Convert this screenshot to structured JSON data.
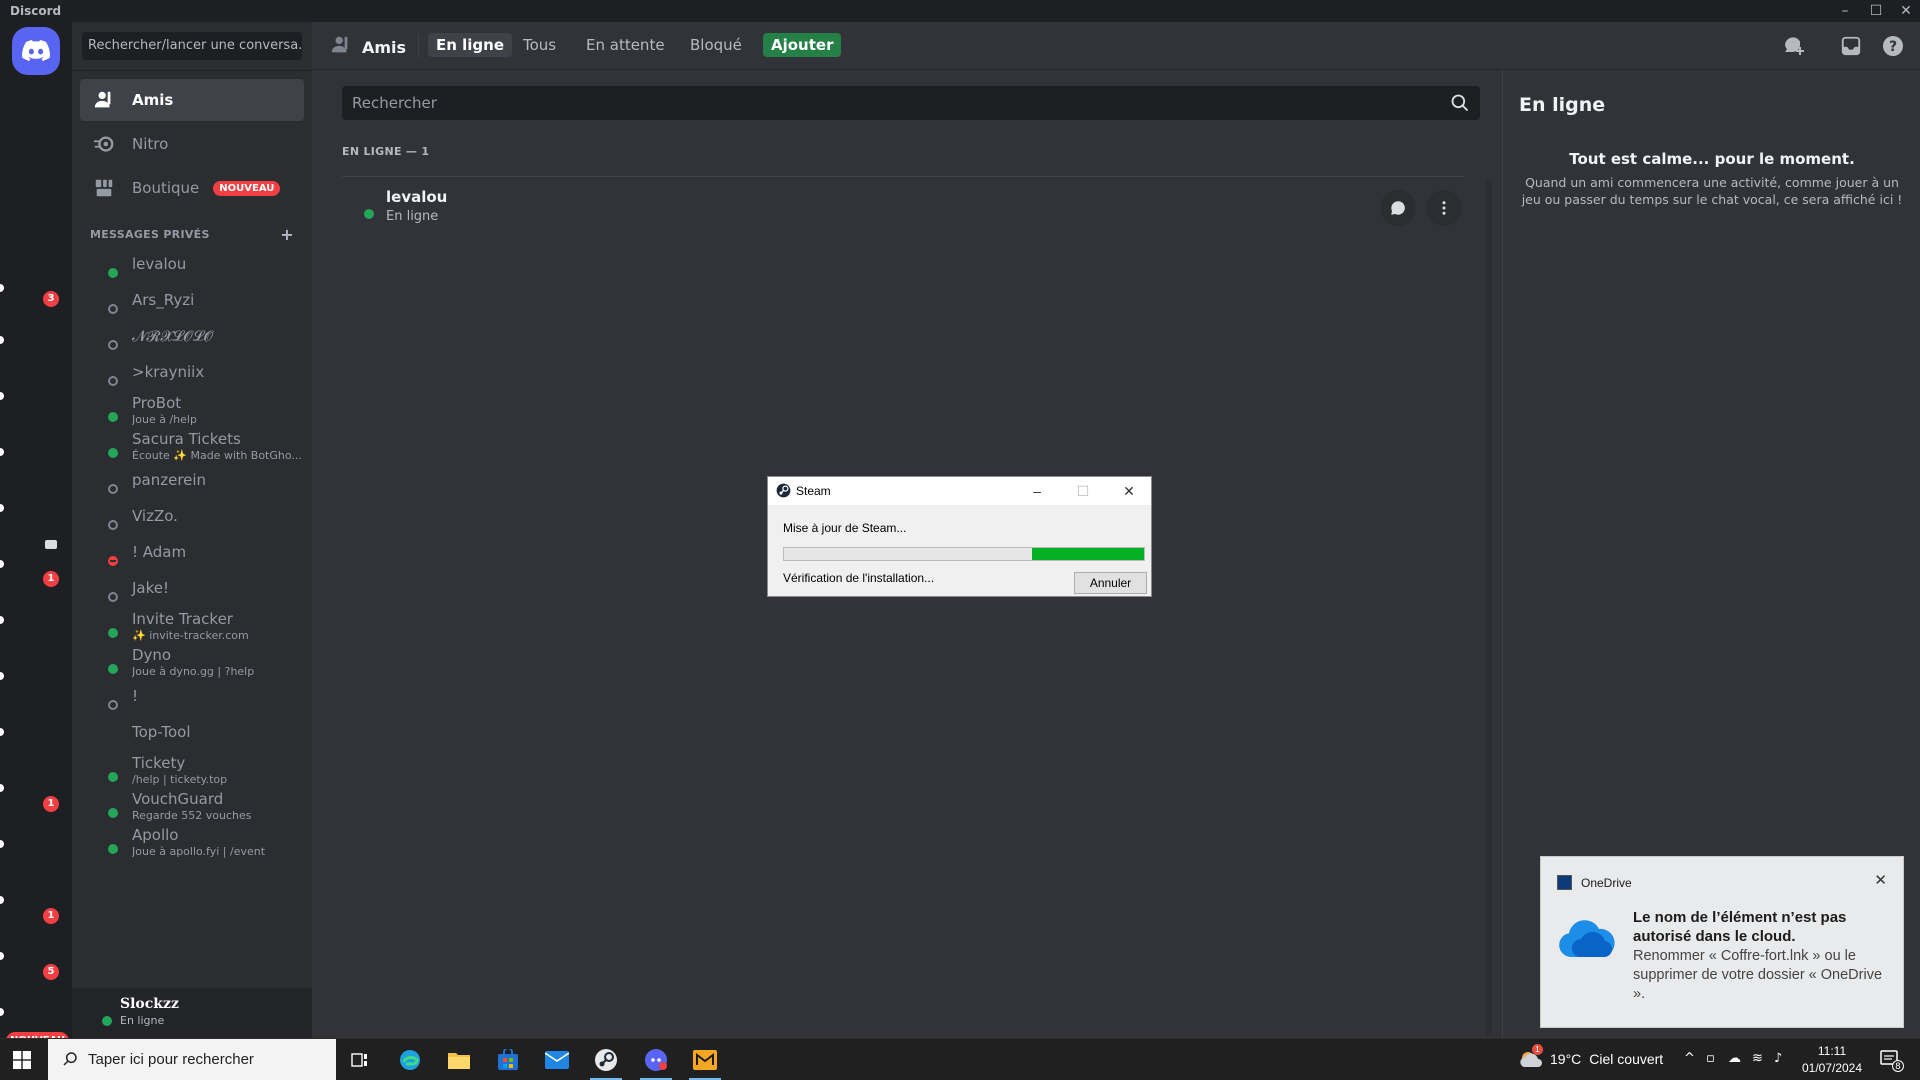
{
  "window": {
    "title": "Discord"
  },
  "rail": {
    "badges": [
      "3",
      "1",
      "1",
      "1",
      "5"
    ],
    "new_label": "NOUVEAU"
  },
  "sidebar": {
    "search_placeholder": "Rechercher/lancer une conversa...",
    "nav": [
      {
        "label": "Amis",
        "icon": "friends-icon"
      },
      {
        "label": "Nitro",
        "icon": "nitro-icon"
      },
      {
        "label": "Boutique",
        "icon": "shop-icon",
        "badge": "NOUVEAU"
      }
    ],
    "dm_header": "MESSAGES PRIVÉS",
    "dms": [
      {
        "name": "levalou",
        "sub": "",
        "status": "online"
      },
      {
        "name": "Ars_Ryzi",
        "sub": "",
        "status": "offline"
      },
      {
        "name": "𝓝𝓡𝓧𝓛𝓞𝓛𝓞",
        "sub": "",
        "status": "offline"
      },
      {
        "name": ">krayniix",
        "sub": "",
        "status": "offline"
      },
      {
        "name": "ProBot",
        "sub": "Joue à /help",
        "status": "online"
      },
      {
        "name": "Sacura Tickets",
        "sub": "Écoute ✨ Made with BotGho...",
        "status": "online"
      },
      {
        "name": "panzerein",
        "sub": "",
        "status": "offline"
      },
      {
        "name": "VizZo.",
        "sub": "",
        "status": "offline"
      },
      {
        "name": "! Adam",
        "sub": "",
        "status": "dnd"
      },
      {
        "name": "Jake!",
        "sub": "",
        "status": "offline"
      },
      {
        "name": "Invite Tracker",
        "sub": "✨ invite-tracker.com",
        "status": "online"
      },
      {
        "name": "Dyno",
        "sub": "Joue à dyno.gg | ?help",
        "status": "online"
      },
      {
        "name": "!",
        "sub": "",
        "status": "offline"
      },
      {
        "name": "Top-Tool",
        "sub": "",
        "status": "none"
      },
      {
        "name": "Tickety",
        "sub": "/help | tickety.top",
        "status": "online"
      },
      {
        "name": "VouchGuard",
        "sub": "Regarde 552 vouches",
        "status": "online"
      },
      {
        "name": "Apollo",
        "sub": "Joue à apollo.fyi | /event",
        "status": "online"
      }
    ]
  },
  "user": {
    "name": "Slockzz",
    "status": "En ligne"
  },
  "header": {
    "title": "Amis",
    "tabs": [
      "En ligne",
      "Tous",
      "En attente",
      "Bloqué"
    ],
    "add_label": "Ajouter"
  },
  "main": {
    "search_placeholder": "Rechercher",
    "online_count": "EN LIGNE — 1",
    "friends": [
      {
        "name": "levalou",
        "status": "En ligne"
      }
    ]
  },
  "activity": {
    "title": "En ligne",
    "heading": "Tout est calme... pour le moment.",
    "description": "Quand un ami commencera une activité, comme jouer à un jeu ou passer du temps sur le chat vocal, ce sera affiché ici !"
  },
  "steam_dialog": {
    "title": "Steam",
    "message": "Mise à jour de Steam...",
    "status": "Vérification de l'installation...",
    "cancel_label": "Annuler",
    "progress_start": 0.69,
    "progress_end": 1.0
  },
  "toast": {
    "app": "OneDrive",
    "title": "Le nom de l’élément n’est pas autorisé dans le cloud.",
    "body": "Renommer « Coffre-fort.lnk » ou le supprimer de votre dossier « OneDrive »."
  },
  "taskbar": {
    "search_placeholder": "Taper ici pour rechercher",
    "weather_temp": "19°C",
    "weather_text": "Ciel couvert",
    "weather_badge": "1",
    "time": "11:11",
    "date": "01/07/2024",
    "notification_count": "8"
  },
  "colors": {
    "blurple": "#5865f2",
    "online": "#23a55a",
    "dnd": "#f23f43",
    "offline": "#80848e",
    "steam_progress": "#06b025",
    "add_button": "#248046"
  }
}
